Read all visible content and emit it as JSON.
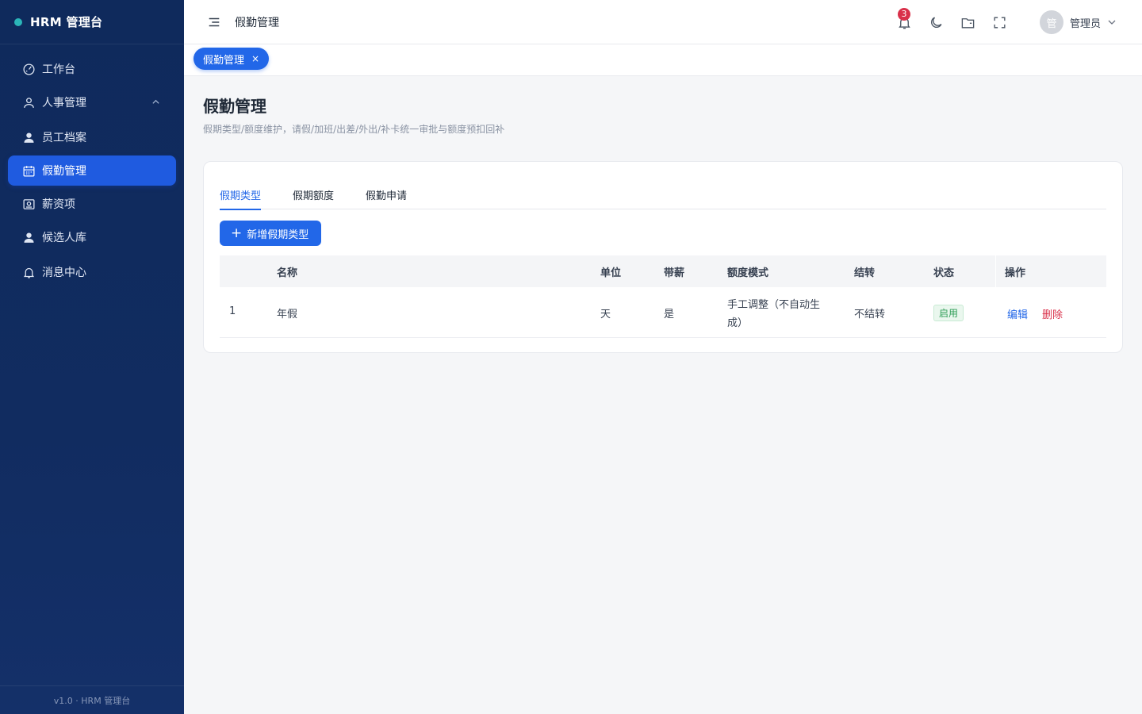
{
  "app": {
    "brand": "HRM 管理台",
    "version": "v1.0 · HRM 管理台"
  },
  "sidebar": {
    "items": [
      {
        "label": "工作台",
        "icon": "dashboard-icon"
      },
      {
        "label": "人事管理",
        "icon": "user-outline-icon",
        "expanded": true
      },
      {
        "label": "员工档案",
        "icon": "user-filled-icon"
      },
      {
        "label": "假勤管理",
        "icon": "calendar-icon",
        "active": true
      },
      {
        "label": "薪资项",
        "icon": "salary-icon"
      },
      {
        "label": "候选人库",
        "icon": "user-filled-icon"
      },
      {
        "label": "消息中心",
        "icon": "bell-icon"
      }
    ]
  },
  "header": {
    "title": "假勤管理",
    "notification_count": "3",
    "user": {
      "avatar_text": "管",
      "name": "管理员"
    }
  },
  "tabsbar": {
    "tabs": [
      {
        "label": "假勤管理",
        "close": "×"
      }
    ]
  },
  "page": {
    "title": "假勤管理",
    "description": "假期类型/额度维护，请假/加班/出差/外出/补卡统一审批与额度预扣回补"
  },
  "card": {
    "tabs": [
      "假期类型",
      "假期额度",
      "假勤申请"
    ],
    "active_tab": "假期类型",
    "add_button": "新增假期类型",
    "table": {
      "columns": [
        "名称",
        "单位",
        "带薪",
        "额度模式",
        "结转",
        "状态",
        "操作"
      ],
      "rows": [
        {
          "index": "1",
          "name": "年假",
          "unit": "天",
          "paid": "是",
          "quota_mode_line1": "手工调整（不自动生",
          "quota_mode_line2": "成）",
          "carry_over": "不结转",
          "status": "启用",
          "actions": {
            "edit": "编辑",
            "delete": "删除"
          }
        }
      ]
    }
  },
  "colors": {
    "sidebar_bg": "#0f2a5c",
    "accent": "#2267e8",
    "danger": "#d9304a",
    "success": "#2f9e57"
  }
}
